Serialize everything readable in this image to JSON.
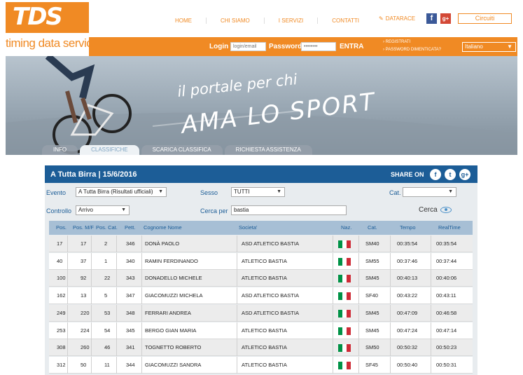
{
  "brand": {
    "logo": "TDS",
    "tagline": "timing data service"
  },
  "nav": [
    "HOME",
    "CHI SIAMO",
    "I SERVIZI",
    "CONTATTI"
  ],
  "datarace": "DATARACE",
  "circuiti": "Circuiti",
  "login": {
    "login_label": "Login",
    "login_placeholder": "login/email",
    "password_label": "Password",
    "password_value": "••••••••",
    "entra": "ENTRA",
    "registrati": "› REGISTRATI",
    "forgot": "› PASSWORD DIMENTICATA?",
    "language": "Italiano"
  },
  "banner": {
    "line1": "il portale per chi",
    "line2": "AMA LO SPORT"
  },
  "tabs": [
    "INFO",
    "CLASSIFICHE",
    "SCARICA CLASSIFICA",
    "RICHIESTA ASSISTENZA"
  ],
  "panel": {
    "title": "A Tutta Birra  |  15/6/2016",
    "share": "SHARE ON",
    "filters": {
      "evento_label": "Evento",
      "evento_value": "A Tutta Birra (Risultati ufficiali)",
      "sesso_label": "Sesso",
      "sesso_value": "TUTTI",
      "cat_label": "Cat.",
      "cat_value": "",
      "controllo_label": "Controllo",
      "controllo_value": "Arrivo",
      "cerca_per_label": "Cerca per",
      "cerca_per_value": "bastia",
      "cerca_btn": "Cerca"
    },
    "columns": [
      "Pos.",
      "Pos. M/F",
      "Pos. Cat.",
      "Pett.",
      "Cognome Nome",
      "Societa'",
      "Naz.",
      "Cat.",
      "Tempo",
      "RealTime"
    ],
    "rows": [
      [
        "17",
        "17",
        "2",
        "346",
        "DONÀ PAOLO",
        "ASD ATLETICO BASTIA",
        "SM40",
        "00:35:54",
        "00:35:54"
      ],
      [
        "40",
        "37",
        "1",
        "340",
        "RAMIN FERDINANDO",
        "ATLETICO BASTIA",
        "SM55",
        "00:37:46",
        "00:37:44"
      ],
      [
        "100",
        "92",
        "22",
        "343",
        "DONADELLO MICHELE",
        "ATLETICO BASTIA",
        "SM45",
        "00:40:13",
        "00:40:06"
      ],
      [
        "162",
        "13",
        "5",
        "347",
        "GIACOMUZZI MICHELA",
        "ASD ATLETICO BASTIA",
        "SF40",
        "00:43:22",
        "00:43:11"
      ],
      [
        "249",
        "220",
        "53",
        "348",
        "FERRARI ANDREA",
        "ASD ATLETICO BASTIA",
        "SM45",
        "00:47:09",
        "00:46:58"
      ],
      [
        "253",
        "224",
        "54",
        "345",
        "BERGO GIAN MARIA",
        "ATLETICO BASTIA",
        "SM45",
        "00:47:24",
        "00:47:14"
      ],
      [
        "308",
        "260",
        "46",
        "341",
        "TOGNETTO ROBERTO",
        "ATLETICO BASTIA",
        "SM50",
        "00:50:32",
        "00:50:23"
      ],
      [
        "312",
        "50",
        "11",
        "344",
        "GIACOMUZZI SANDRA",
        "ATLETICO BASTIA",
        "SF45",
        "00:50:40",
        "00:50:31"
      ]
    ]
  },
  "colors": {
    "orange": "#f08a24",
    "blue": "#1c5d97",
    "flag_green": "#009246",
    "flag_white": "#ffffff",
    "flag_red": "#ce2b37"
  }
}
